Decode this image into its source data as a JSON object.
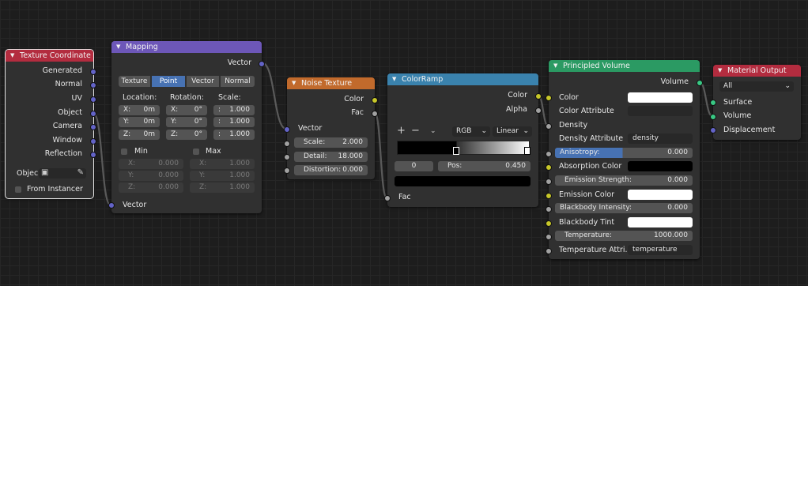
{
  "nodes": {
    "texcoord": {
      "title": "Texture Coordinate",
      "outputs": [
        "Generated",
        "Normal",
        "UV",
        "Object",
        "Camera",
        "Window",
        "Reflection"
      ],
      "object_label": "Objec",
      "from_instancer": "From Instancer",
      "header_color": "#b32c3f"
    },
    "mapping": {
      "title": "Mapping",
      "output": "Vector",
      "types": [
        "Texture",
        "Point",
        "Vector",
        "Normal"
      ],
      "active_type": "Point",
      "location_label": "Location:",
      "rotation_label": "Rotation:",
      "scale_label": "Scale:",
      "location": [
        {
          "axis": "X:",
          "value": "0m"
        },
        {
          "axis": "Y:",
          "value": "0m"
        },
        {
          "axis": "Z:",
          "value": "0m"
        }
      ],
      "rotation": [
        {
          "axis": "X:",
          "value": "0°"
        },
        {
          "axis": "Y:",
          "value": "0°"
        },
        {
          "axis": "Z:",
          "value": "0°"
        }
      ],
      "scale": [
        {
          "axis": ":",
          "value": "1.000"
        },
        {
          "axis": ":",
          "value": "1.000"
        },
        {
          "axis": ":",
          "value": "1.000"
        }
      ],
      "min_label": "Min",
      "max_label": "Max",
      "min": [
        {
          "axis": "X:",
          "value": "0.000"
        },
        {
          "axis": "Y:",
          "value": "0.000"
        },
        {
          "axis": "Z:",
          "value": "0.000"
        }
      ],
      "max": [
        {
          "axis": "X:",
          "value": "1.000"
        },
        {
          "axis": "Y:",
          "value": "1.000"
        },
        {
          "axis": "Z:",
          "value": "1.000"
        }
      ],
      "input": "Vector",
      "header_color": "#6d57b8"
    },
    "noise": {
      "title": "Noise Texture",
      "outputs": [
        "Color",
        "Fac"
      ],
      "input": "Vector",
      "fields": [
        {
          "label": "Scale:",
          "value": "2.000"
        },
        {
          "label": "Detail:",
          "value": "18.000"
        },
        {
          "label": "Distortion:",
          "value": "0.000"
        }
      ],
      "header_color": "#c16a2c"
    },
    "colorramp": {
      "title": "ColorRamp",
      "outputs": [
        "Color",
        "Alpha"
      ],
      "plus": "+",
      "minus": "−",
      "mode": "RGB",
      "interp": "Linear",
      "index": "0",
      "pos_label": "Pos:",
      "pos_value": "0.450",
      "input": "Fac",
      "header_color": "#3a82ad"
    },
    "volume": {
      "title": "Principled Volume",
      "output": "Volume",
      "rows": [
        {
          "label": "Color",
          "kind": "color",
          "value": "#ffffff"
        },
        {
          "label": "Color Attribute",
          "kind": "text",
          "value": ""
        },
        {
          "label": "Density",
          "kind": "socket",
          "value": ""
        },
        {
          "label": "Density Attribute",
          "kind": "text",
          "value": "density"
        },
        {
          "label": "Anisotropy:",
          "kind": "slider",
          "value": "0.000"
        },
        {
          "label": "Absorption Color",
          "kind": "color",
          "value": "#000000"
        },
        {
          "label": "Emission Strength:",
          "kind": "num",
          "value": "0.000"
        },
        {
          "label": "Emission Color",
          "kind": "color",
          "value": "#ffffff"
        },
        {
          "label": "Blackbody Intensity:",
          "kind": "num",
          "value": "0.000"
        },
        {
          "label": "Blackbody Tint",
          "kind": "color",
          "value": "#ffffff"
        },
        {
          "label": "Temperature:",
          "kind": "num",
          "value": "1000.000"
        },
        {
          "label": "Temperature Attri..",
          "kind": "text",
          "value": "temperature"
        }
      ],
      "header_color": "#2b9a63"
    },
    "output": {
      "title": "Material Output",
      "target": "All",
      "inputs": [
        "Surface",
        "Volume",
        "Displacement"
      ],
      "header_color": "#b32c3f"
    }
  }
}
